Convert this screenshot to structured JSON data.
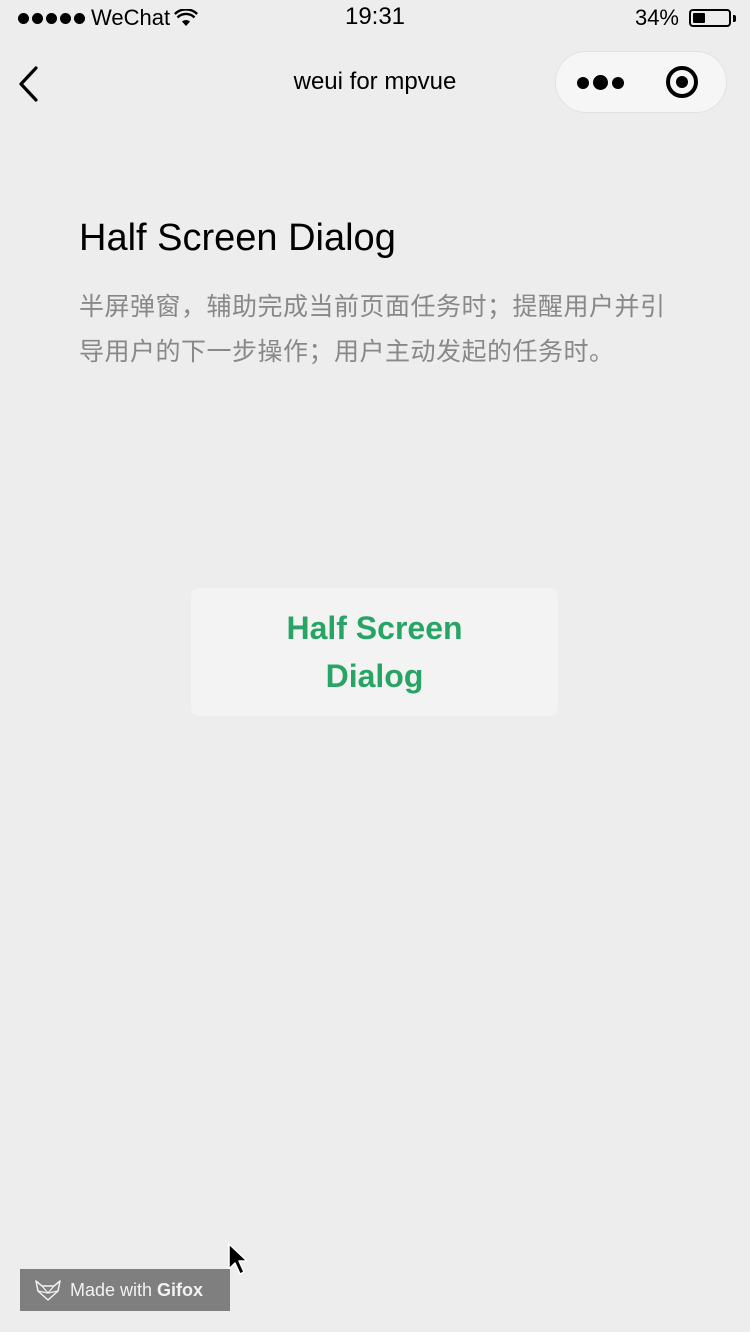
{
  "status_bar": {
    "carrier": "WeChat",
    "time": "19:31",
    "battery_percent": "34%",
    "battery_level": 0.34
  },
  "nav_bar": {
    "title": "weui for mpvue"
  },
  "page": {
    "title": "Half Screen Dialog",
    "description": "半屏弹窗，辅助完成当前页面任务时；提醒用户并引导用户的下一步操作；用户主动发起的任务时。"
  },
  "button": {
    "label": "Half Screen Dialog",
    "text_color": "#28A564"
  },
  "watermark": {
    "made_with": "Made with",
    "brand": "Gifox"
  },
  "colors": {
    "background": "#EDEDED",
    "accent": "#28A564",
    "description": "#888888"
  }
}
